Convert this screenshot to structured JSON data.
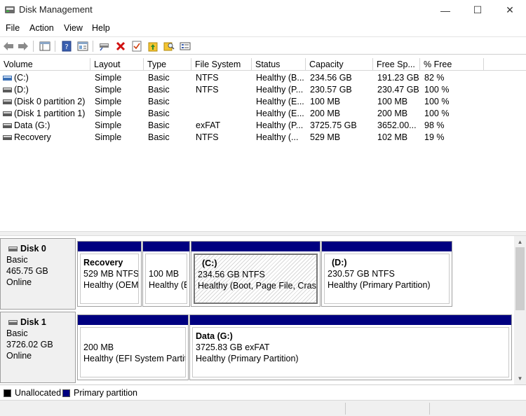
{
  "window": {
    "title": "Disk Management",
    "minimize": "—",
    "maximize": "☐",
    "close": "✕"
  },
  "menu": [
    "File",
    "Action",
    "View",
    "Help"
  ],
  "toolbar": {
    "icons": [
      "back-icon",
      "forward-icon",
      "show-hide-console-tree-icon",
      "help-icon",
      "properties-icon",
      "connect-disk-icon",
      "delete-icon",
      "check-icon",
      "folder-up-icon",
      "search-folder-icon",
      "settings-list-icon"
    ]
  },
  "volume_list": {
    "columns": [
      "Volume",
      "Layout",
      "Type",
      "File System",
      "Status",
      "Capacity",
      "Free Sp...",
      "% Free"
    ],
    "rows": [
      {
        "volume": "(C:)",
        "layout": "Simple",
        "type": "Basic",
        "fs": "NTFS",
        "status": "Healthy (B...",
        "capacity": "234.56 GB",
        "free": "191.23 GB",
        "pct": "82 %"
      },
      {
        "volume": "(D:)",
        "layout": "Simple",
        "type": "Basic",
        "fs": "NTFS",
        "status": "Healthy (P...",
        "capacity": "230.57 GB",
        "free": "230.47 GB",
        "pct": "100 %"
      },
      {
        "volume": "(Disk 0 partition 2)",
        "layout": "Simple",
        "type": "Basic",
        "fs": "",
        "status": "Healthy (E...",
        "capacity": "100 MB",
        "free": "100 MB",
        "pct": "100 %"
      },
      {
        "volume": "(Disk 1 partition 1)",
        "layout": "Simple",
        "type": "Basic",
        "fs": "",
        "status": "Healthy (E...",
        "capacity": "200 MB",
        "free": "200 MB",
        "pct": "100 %"
      },
      {
        "volume": "Data (G:)",
        "layout": "Simple",
        "type": "Basic",
        "fs": "exFAT",
        "status": "Healthy (P...",
        "capacity": "3725.75 GB",
        "free": "3652.00...",
        "pct": "98 %"
      },
      {
        "volume": "Recovery",
        "layout": "Simple",
        "type": "Basic",
        "fs": "NTFS",
        "status": "Healthy (...",
        "capacity": "529 MB",
        "free": "102 MB",
        "pct": "19 %"
      }
    ]
  },
  "disks": [
    {
      "name": "Disk 0",
      "type": "Basic",
      "size": "465.75 GB",
      "state": "Online",
      "partitions": [
        {
          "name": "Recovery",
          "line1": "529 MB NTFS",
          "line2": "Healthy (OEM"
        },
        {
          "name": "",
          "line1": "100 MB",
          "line2": "Healthy (E"
        },
        {
          "name": "(C:)",
          "line1": "234.56 GB NTFS",
          "line2": "Healthy (Boot, Page File, Crash D"
        },
        {
          "name": "(D:)",
          "line1": "230.57 GB NTFS",
          "line2": "Healthy (Primary Partition)"
        }
      ]
    },
    {
      "name": "Disk 1",
      "type": "Basic",
      "size": "3726.02 GB",
      "state": "Online",
      "partitions": [
        {
          "name": "",
          "line1": "200 MB",
          "line2": "Healthy (EFI System Partitic"
        },
        {
          "name": "Data  (G:)",
          "line1": "3725.83 GB exFAT",
          "line2": "Healthy (Primary Partition)"
        }
      ]
    }
  ],
  "legend": [
    {
      "label": "Unallocated",
      "color": "#000000"
    },
    {
      "label": "Primary partition",
      "color": "#000080"
    }
  ]
}
